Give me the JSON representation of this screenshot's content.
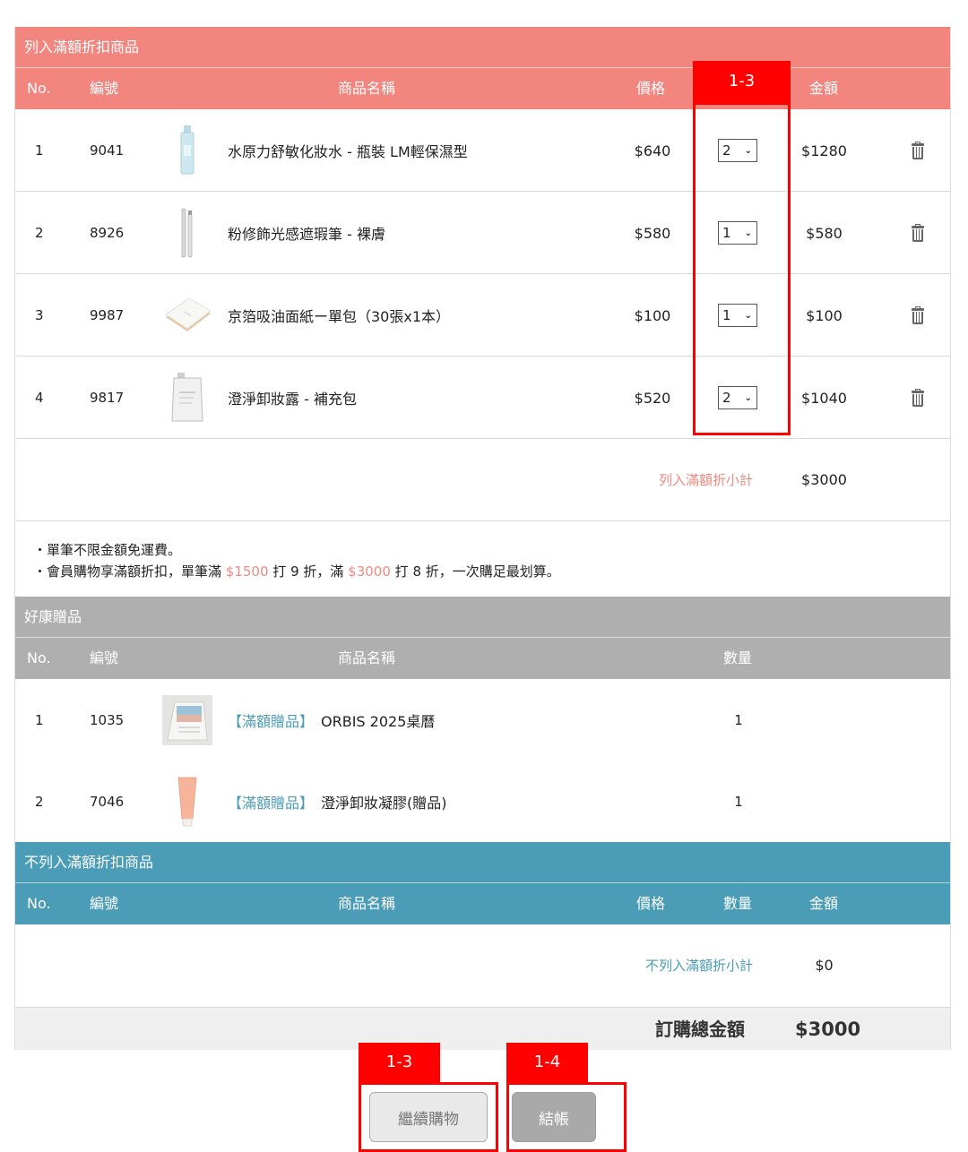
{
  "discount_section": {
    "title": "列入滿額折扣商品",
    "headers": {
      "no": "No.",
      "code": "編號",
      "name": "商品名稱",
      "price": "價格",
      "amount": "金額"
    },
    "items": [
      {
        "no": "1",
        "code": "9041",
        "name": "水原力舒敏化妝水 - 瓶裝 LM輕保濕型",
        "price": "$640",
        "qty": "2",
        "amount": "$1280",
        "image": "toner-bottle"
      },
      {
        "no": "2",
        "code": "8926",
        "name": "粉修飾光感遮瑕筆 - 裸膚",
        "price": "$580",
        "qty": "1",
        "amount": "$580",
        "image": "concealer-pen"
      },
      {
        "no": "3",
        "code": "9987",
        "name": "京箔吸油面紙ー單包（30張x1本）",
        "price": "$100",
        "qty": "1",
        "amount": "$100",
        "image": "blotting-paper"
      },
      {
        "no": "4",
        "code": "9817",
        "name": "澄淨卸妝露 - 補充包",
        "price": "$520",
        "qty": "2",
        "amount": "$1040",
        "image": "refill-pouch"
      }
    ],
    "subtotal_label": "列入滿額折小計",
    "subtotal_value": "$3000"
  },
  "notes": {
    "line1": "・單筆不限金額免運費。",
    "line2_prefix": "・會員購物享滿額折扣，單筆滿",
    "line2_amount1": "$1500",
    "line2_mid": "打 9 折，滿",
    "line2_amount2": "$3000",
    "line2_suffix": "打 8 折，一次購足最划算。"
  },
  "gift_section": {
    "title": "好康贈品",
    "headers": {
      "no": "No.",
      "code": "編號",
      "name": "商品名稱",
      "qty": "數量"
    },
    "items": [
      {
        "no": "1",
        "code": "1035",
        "tag": "【滿額贈品】",
        "name": "ORBIS 2025桌曆",
        "qty": "1",
        "image": "desk-calendar"
      },
      {
        "no": "2",
        "code": "7046",
        "tag": "【滿額贈品】",
        "name": "澄淨卸妝凝膠(贈品)",
        "qty": "1",
        "image": "gel-tube"
      }
    ]
  },
  "nondiscount_section": {
    "title": "不列入滿額折扣商品",
    "headers": {
      "no": "No.",
      "code": "編號",
      "name": "商品名稱",
      "price": "價格",
      "qty": "數量",
      "amount": "金額"
    },
    "subtotal_label": "不列入滿額折小計",
    "subtotal_value": "$0"
  },
  "total": {
    "label": "訂購總金額",
    "value": "$3000"
  },
  "buttons": {
    "continue": "繼續購物",
    "checkout": "結帳"
  },
  "annotations": {
    "qty_column": "1-3",
    "continue_button": "1-3",
    "checkout_button": "1-4"
  },
  "colors": {
    "discount": "#f3857f",
    "gift": "#afafaf",
    "nondiscount": "#4a9cb7",
    "marker": "#ff0000",
    "highlight_text": "#f08a80"
  }
}
